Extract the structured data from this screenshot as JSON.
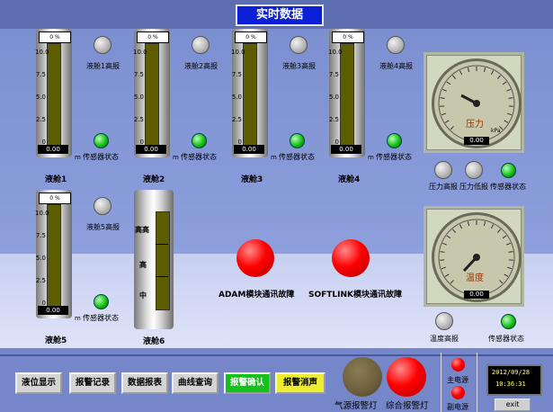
{
  "window_title": "实时数据",
  "tanks": [
    {
      "name": "液舱1",
      "top_value": "0 %",
      "bottom_value": "0.00",
      "unit": "m",
      "alarm_label": "液舱1高报",
      "sensor_label": "传感器状态"
    },
    {
      "name": "液舱2",
      "top_value": "0 %",
      "bottom_value": "0.00",
      "unit": "m",
      "alarm_label": "液舱2高报",
      "sensor_label": "传感器状态"
    },
    {
      "name": "液舱3",
      "top_value": "0 %",
      "bottom_value": "0.00",
      "unit": "m",
      "alarm_label": "液舱3高报",
      "sensor_label": "传感器状态"
    },
    {
      "name": "液舱4",
      "top_value": "0 %",
      "bottom_value": "0.00",
      "unit": "m",
      "alarm_label": "液舱4高报",
      "sensor_label": "传感器状态"
    },
    {
      "name": "液舱5",
      "top_value": "0 %",
      "bottom_value": "0.00",
      "unit": "m",
      "alarm_label": "液舱5高报",
      "sensor_label": "传感器状态"
    }
  ],
  "scale_labels": [
    "10.0",
    "7.5",
    "5.0",
    "2.5",
    "0"
  ],
  "tank6": {
    "name": "液舱6",
    "levels": [
      "高高",
      "高",
      "中"
    ]
  },
  "pressure_gauge": {
    "label": "压力",
    "unit": "kPa",
    "value": "0.00",
    "alarm_high": "压力高报",
    "alarm_low": "压力低报",
    "sensor_label": "传感器状态"
  },
  "temp_gauge": {
    "label": "温度",
    "value": "0.00",
    "alarm_high": "温度高报",
    "sensor_label": "传感器状态"
  },
  "faults": {
    "adam": "ADAM模块通讯故障",
    "softlink": "SOFTLINK模块通讯故障"
  },
  "buttons": [
    "液位显示",
    "报警记录",
    "数据报表",
    "曲线查询",
    "报警确认",
    "报警消声"
  ],
  "lamps": {
    "gas": "气源报警灯",
    "general": "综合报警灯",
    "main_power": "主电源",
    "backup_power": "副电源"
  },
  "clock": {
    "date": "2012/09/28",
    "time": "10:36:31"
  },
  "exit_label": "exit"
}
